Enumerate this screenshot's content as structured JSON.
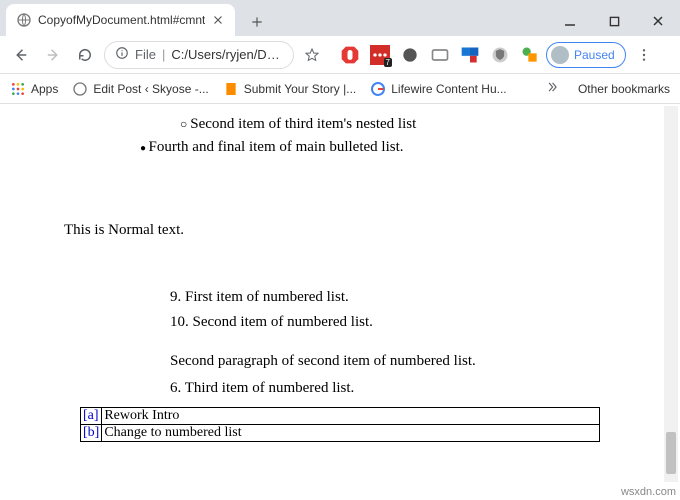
{
  "tab": {
    "title": "CopyofMyDocument.html#cmnt"
  },
  "omnibox": {
    "scheme": "File",
    "path": "C:/Users/ryjen/Docu..."
  },
  "profile": {
    "label": "Paused"
  },
  "bookmarks": {
    "apps": "Apps",
    "items": [
      "Edit Post ‹ Skyose -...",
      "Submit Your Story |...",
      "Lifewire Content Hu..."
    ],
    "other": "Other bookmarks"
  },
  "doc": {
    "nestedSecond": "Second item of third item's nested list",
    "fourth": "Fourth and final item of main bulleted list.",
    "normal": "This is Normal text.",
    "ol": [
      {
        "n": "9.",
        "t": "First item of numbered list."
      },
      {
        "n": "10.",
        "t": "Second item of numbered list."
      }
    ],
    "secondPara": "Second paragraph of second item of numbered list.",
    "third": {
      "n": "6.",
      "t": "Third item of numbered list."
    },
    "comments": [
      {
        "tag": "[a]",
        "text": "Rework Intro"
      },
      {
        "tag": "[b]",
        "text": "Change to numbered list"
      }
    ]
  },
  "watermark": "wsxdn.com"
}
